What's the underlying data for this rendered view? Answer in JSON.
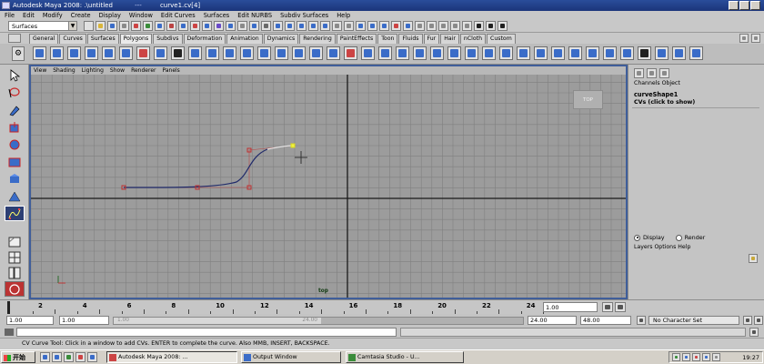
{
  "window": {
    "app_title": "Autodesk Maya 2008: .\\untitled",
    "separator": "---",
    "doc_title": "curve1.cv[4]"
  },
  "menubar": [
    "File",
    "Edit",
    "Modify",
    "Create",
    "Display",
    "Window",
    "Edit Curves",
    "Surfaces",
    "Edit NURBS",
    "Subdiv Surfaces",
    "Help"
  ],
  "mode_selector": {
    "value": "Surfaces"
  },
  "shelf_tabs": [
    {
      "label": "General",
      "active": false
    },
    {
      "label": "Curves",
      "active": false
    },
    {
      "label": "Surfaces",
      "active": false
    },
    {
      "label": "Polygons",
      "active": true
    },
    {
      "label": "Subdivs",
      "active": false
    },
    {
      "label": "Deformation",
      "active": false
    },
    {
      "label": "Animation",
      "active": false
    },
    {
      "label": "Dynamics",
      "active": false
    },
    {
      "label": "Rendering",
      "active": false
    },
    {
      "label": "PaintEffects",
      "active": false
    },
    {
      "label": "Toon",
      "active": false
    },
    {
      "label": "Fluids",
      "active": false
    },
    {
      "label": "Fur",
      "active": false
    },
    {
      "label": "Hair",
      "active": false
    },
    {
      "label": "nCloth",
      "active": false
    },
    {
      "label": "Custom",
      "active": false
    }
  ],
  "viewport": {
    "menus": [
      "View",
      "Shading",
      "Lighting",
      "Show",
      "Renderer",
      "Panels"
    ],
    "view_cube_label": "TOP",
    "camera_label": "top"
  },
  "channel_box": {
    "menus": "Channels  Object",
    "object_name": "curveShape1",
    "cvs_label": "CVs (click to show)",
    "display_label": "Display",
    "render_label": "Render",
    "layer_menus": "Layers  Options  Help"
  },
  "time_slider": {
    "ticks": [
      "2",
      "4",
      "6",
      "8",
      "10",
      "12",
      "14",
      "16",
      "18",
      "20",
      "22",
      "24"
    ],
    "current_frame": "1.00"
  },
  "range_slider": {
    "start_time": "1.00",
    "playback_start": "1.00",
    "handle_start": "1.00",
    "handle_end": "24.00",
    "playback_end": "24.00",
    "end_time": "48.00",
    "character_set": "No Character Set"
  },
  "help_line": "CV Curve Tool: Click in a window to add CVs. ENTER to complete the curve. Also MMB, INSERT, BACKSPACE.",
  "taskbar": {
    "start_label": "开始",
    "tasks": [
      {
        "label": "Autodesk Maya 2008: ..."
      },
      {
        "label": "Output Window"
      },
      {
        "label": "Camtasia Studio - U..."
      }
    ],
    "clock": "19:27"
  },
  "colors": {
    "title_bar": "#1f3f8a",
    "viewport_bg": "#9c9c9c",
    "viewport_frame": "#3f5e9a",
    "curve_color": "#202a6a",
    "cv_marker": "#c03030",
    "last_cv": "#f0f040"
  },
  "icons": [
    "select-arrow-icon",
    "lasso-icon",
    "paint-select-icon",
    "move-icon",
    "rotate-icon",
    "scale-icon",
    "manipulator-icon",
    "last-tool-icon",
    "single-pane-icon",
    "four-pane-icon",
    "outliner-icon",
    "gear-icon",
    "windows-start-icon"
  ]
}
